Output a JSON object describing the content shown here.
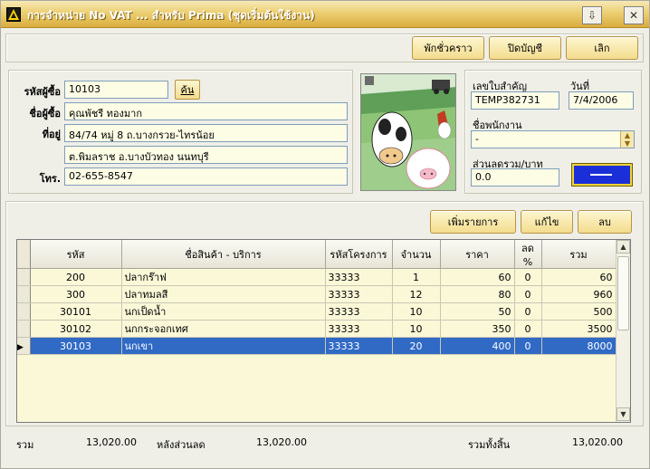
{
  "window": {
    "title": "การจำหน่าย No VAT ... สำหรับ Prima (ชุดเริ่มต้นใช้งาน)"
  },
  "toolbar": {
    "hold_label": "พักชั่วคราว",
    "close_bill_label": "ปิดบัญชี",
    "cancel_label": "เลิก"
  },
  "customer": {
    "code_label": "รหัสผู้ซื้อ",
    "code_value": "10103",
    "search_label": "ค้น",
    "name_label": "ชื่อผู้ซื้อ",
    "name_value": "คุณพัชรี ทองมาก",
    "address_label": "ที่อยู่",
    "address_line1": "84/74 หมู่ 8 ถ.บางกรวย-ไทรน้อย",
    "address_line2": "ต.พิมลราช อ.บางบัวทอง นนทบุรี",
    "phone_label": "โทร.",
    "phone_value": "02-655-8547"
  },
  "document": {
    "doc_no_label": "เลขใบสำคัญ",
    "doc_no_value": "TEMP382731",
    "date_label": "วันที่",
    "date_value": "7/4/2006",
    "employee_label": "ชื่อพนักงาน",
    "employee_value": "-",
    "discount_label": "ส่วนลดรวม/บาท",
    "discount_value": "0.0"
  },
  "grid_actions": {
    "add_label": "เพิ่มรายการ",
    "edit_label": "แก้ไข",
    "delete_label": "ลบ"
  },
  "table": {
    "headers": [
      "รหัส",
      "ชื่อสินค้า - บริการ",
      "รหัสโครงการ",
      "จำนวน",
      "ราคา",
      "ลด %",
      "รวม"
    ],
    "rows": [
      [
        "200",
        "ปลากร๊าฟ",
        "33333",
        "1",
        "60",
        "0",
        "60"
      ],
      [
        "300",
        "ปลาทมลสี",
        "33333",
        "12",
        "80",
        "0",
        "960"
      ],
      [
        "30101",
        "นกเป็ดน้ำ",
        "33333",
        "10",
        "50",
        "0",
        "500"
      ],
      [
        "30102",
        "นกกระจอกเทศ",
        "33333",
        "10",
        "350",
        "0",
        "3500"
      ],
      [
        "30103",
        "นกเขา",
        "33333",
        "20",
        "400",
        "0",
        "8000"
      ]
    ],
    "selected_row": 4
  },
  "footer": {
    "total_label": "รวม",
    "total_value": "13,020.00",
    "after_discount_label": "หลังส่วนลด",
    "after_discount_value": "13,020.00",
    "grand_total_label": "รวมทั้งสิ้น",
    "grand_total_value": "13,020.00"
  },
  "colors": {
    "title_gradient_top": "#f7e9b7",
    "title_gradient_bottom": "#d9ad3e",
    "selection": "#316ac5",
    "grid_background": "#fbf8d8",
    "color_swatch": "#1b2fd8"
  },
  "icons": [
    "app-icon",
    "minimize-icon",
    "close-icon",
    "scroll-up-icon",
    "scroll-down-icon",
    "row-pointer-icon",
    "dropdown-icon"
  ]
}
